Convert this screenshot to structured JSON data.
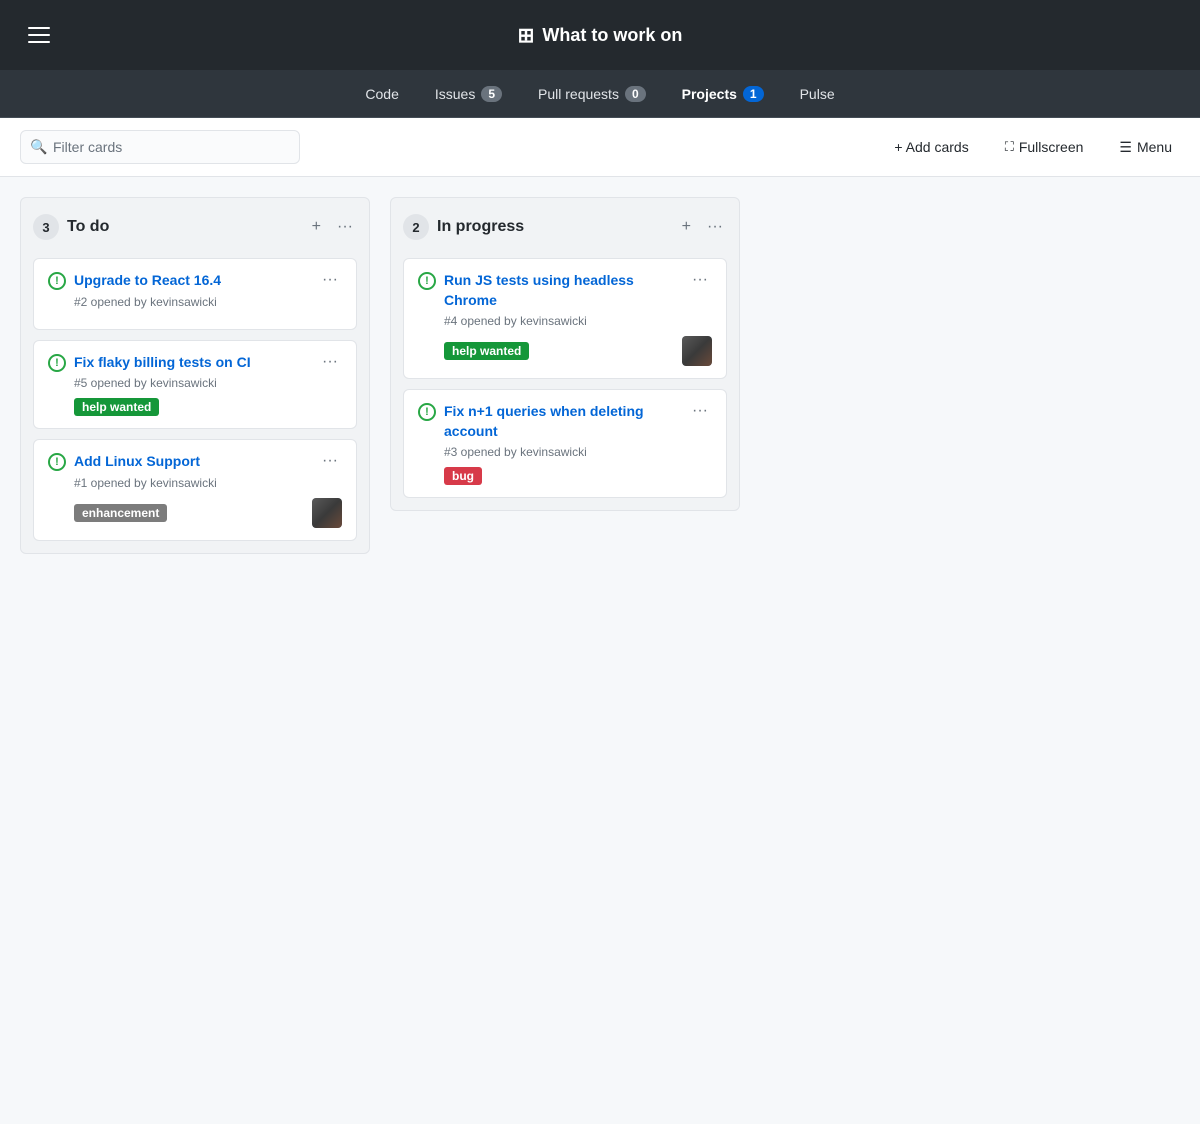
{
  "header": {
    "menu_label": "Menu",
    "title": "What to work on",
    "title_icon": "📋"
  },
  "nav": {
    "items": [
      {
        "key": "code",
        "label": "Code",
        "badge": null,
        "active": false
      },
      {
        "key": "issues",
        "label": "Issues",
        "badge": "5",
        "active": false
      },
      {
        "key": "pull-requests",
        "label": "Pull requests",
        "badge": "0",
        "active": false
      },
      {
        "key": "projects",
        "label": "Projects",
        "badge": "1",
        "active": true
      },
      {
        "key": "pulse",
        "label": "Pulse",
        "badge": null,
        "active": false
      }
    ]
  },
  "toolbar": {
    "filter_placeholder": "Filter cards",
    "add_cards_label": "+ Add cards",
    "fullscreen_label": "Fullscreen",
    "menu_label": "Menu"
  },
  "columns": [
    {
      "id": "todo",
      "count": "3",
      "title": "To do",
      "cards": [
        {
          "id": "card-1",
          "title": "Upgrade to React 16.4",
          "issue_number": "#2",
          "opened_by": "kevinsawicki",
          "labels": [],
          "has_avatar": false
        },
        {
          "id": "card-2",
          "title": "Fix flaky billing tests on CI",
          "issue_number": "#5",
          "opened_by": "kevinsawicki",
          "labels": [
            {
              "text": "help wanted",
              "type": "help"
            }
          ],
          "has_avatar": false
        },
        {
          "id": "card-3",
          "title": "Add Linux Support",
          "issue_number": "#1",
          "opened_by": "kevinsawicki",
          "labels": [
            {
              "text": "enhancement",
              "type": "enhancement"
            }
          ],
          "has_avatar": true
        }
      ]
    },
    {
      "id": "in-progress",
      "count": "2",
      "title": "In progress",
      "cards": [
        {
          "id": "card-4",
          "title": "Run JS tests using headless Chrome",
          "issue_number": "#4",
          "opened_by": "kevinsawicki",
          "labels": [
            {
              "text": "help wanted",
              "type": "help"
            }
          ],
          "has_avatar": true
        },
        {
          "id": "card-5",
          "title": "Fix n+1 queries when deleting account",
          "issue_number": "#3",
          "opened_by": "kevinsawicki",
          "labels": [
            {
              "text": "bug",
              "type": "bug"
            }
          ],
          "has_avatar": false
        }
      ]
    }
  ]
}
